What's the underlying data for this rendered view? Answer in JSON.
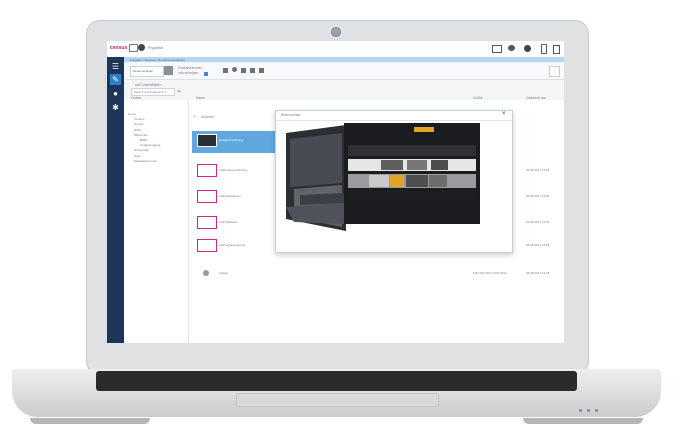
{
  "app": {
    "logo": "census",
    "user": "Peguteste"
  },
  "toolbar": {
    "blue_bar": "Freigabe • Sitemap • Benutzerverwaltung",
    "new_button": "Neues anlegen",
    "filter_label": "Schlüsselwörter",
    "filter_sub": "Info anzeigen"
  },
  "breadcrumb": "ui4Content/Bilder",
  "pager": "Seite 1 von insgesamt 1",
  "columns": {
    "tree": "Ordner",
    "name": "Name",
    "size": "Größe",
    "changed": "Geändert am"
  },
  "tree": [
    {
      "label": "Home",
      "level": 0
    },
    {
      "label": "Content",
      "level": 1
    },
    {
      "label": "System",
      "level": 1
    },
    {
      "label": "DWS",
      "level": 1
    },
    {
      "label": "BildCenter",
      "level": 1
    },
    {
      "label": "Bilder",
      "level": 2,
      "active": true
    },
    {
      "label": "UpdateLogging",
      "level": 2
    },
    {
      "label": "Downloads",
      "level": 1
    },
    {
      "label": "Style",
      "level": 1
    },
    {
      "label": "MetadatenCenter",
      "level": 1
    }
  ],
  "list_header": "Außenm",
  "files": [
    {
      "name": "Designeinrichtung",
      "size": "",
      "date": "",
      "selected": true
    },
    {
      "name": "ui4Designeinrichtung",
      "size": "",
      "date": "25.08.2017 13:52"
    },
    {
      "name": "ui4Publikationen",
      "size": "",
      "date": "25.08.2017 13:50"
    },
    {
      "name": "ui4Publikation",
      "size": "",
      "date": "25.08.2017 13:51"
    },
    {
      "name": "ui4Programmierung",
      "size": "",
      "date": "25.08.2017 13:53"
    },
    {
      "name": "ui4Info",
      "size": "5,84 KB (253 x 150) PNG",
      "date": "25.08.2017 13:48"
    }
  ],
  "modal": {
    "title": "Bildvorschau",
    "close": "×"
  },
  "colors": {
    "accent": "#d7218a",
    "sidebar": "#1d3559",
    "selection": "#5fa7dd",
    "brand": "#e0a524"
  }
}
